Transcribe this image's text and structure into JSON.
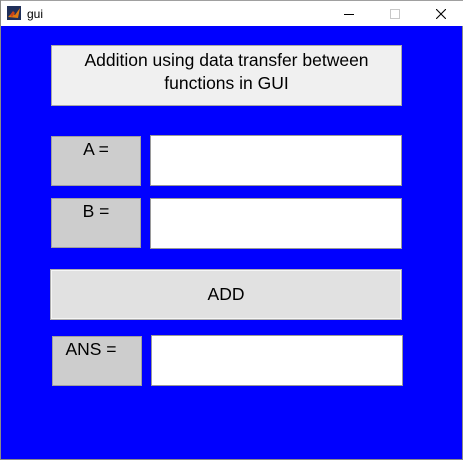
{
  "window": {
    "title": "gui",
    "controls": {
      "minimize_icon": "minimize-icon",
      "maximize_icon": "maximize-icon",
      "close_icon": "close-icon"
    }
  },
  "colors": {
    "figure_background": "#0000ff",
    "panel_gray": "#cdcdcd",
    "heading_background": "#f0f0f0",
    "button_background": "#e1e1e1"
  },
  "form": {
    "heading_line1": "Addition using data transfer between",
    "heading_line2": "functions in GUI",
    "label_a": "A =",
    "input_a_value": "",
    "label_b": "B =",
    "input_b_value": "",
    "add_button": "ADD",
    "label_ans": "ANS =",
    "answer_value": ""
  }
}
